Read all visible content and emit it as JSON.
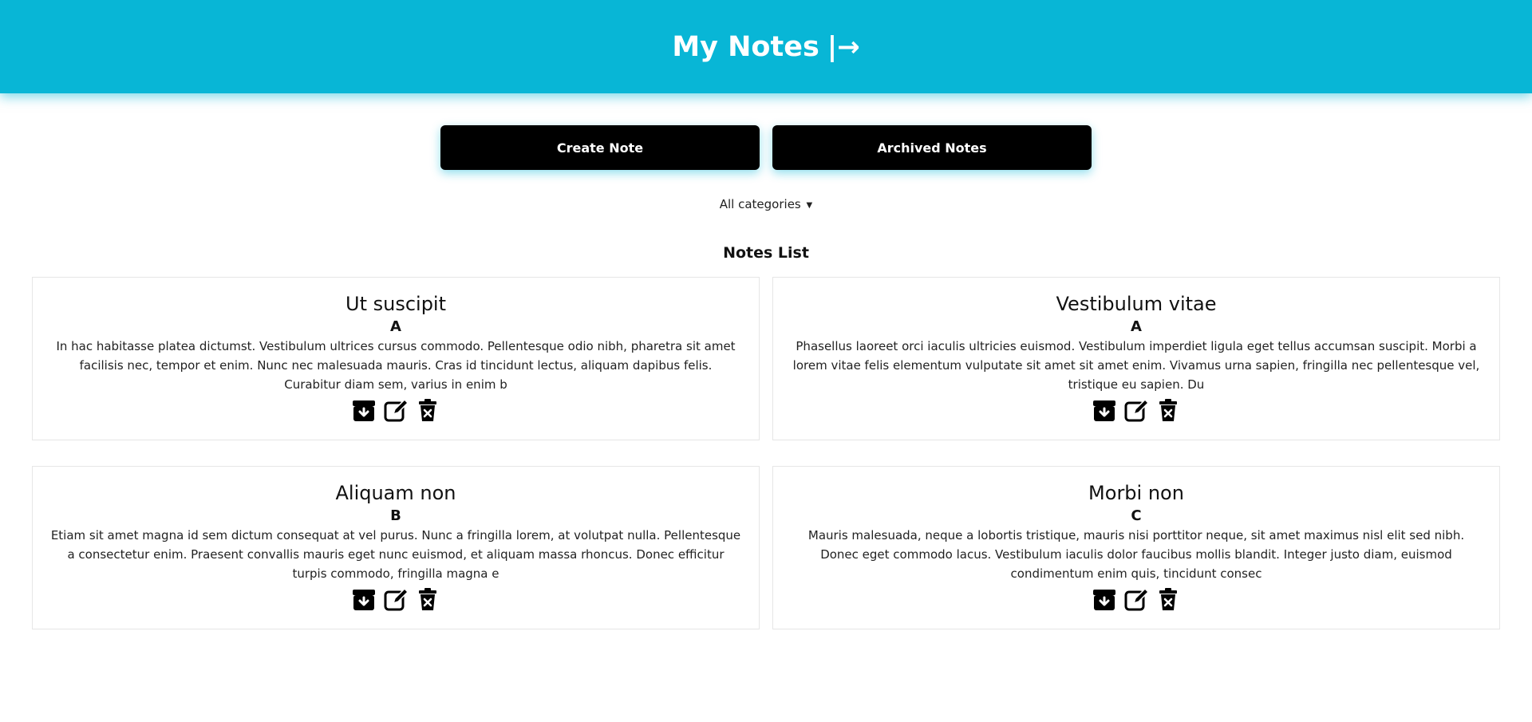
{
  "header": {
    "title": "My Notes",
    "logout_glyph": "|→"
  },
  "actions": {
    "create_label": "Create Note",
    "archived_label": "Archived Notes"
  },
  "filter": {
    "selected": "All categories"
  },
  "list": {
    "title": "Notes List"
  },
  "notes": [
    {
      "title": "Ut suscipit",
      "category": "A",
      "body": "In hac habitasse platea dictumst. Vestibulum ultrices cursus commodo. Pellentesque odio nibh, pharetra sit amet facilisis nec, tempor et enim. Nunc nec malesuada mauris. Cras id tincidunt lectus, aliquam dapibus felis. Curabitur diam sem, varius in enim b"
    },
    {
      "title": "Vestibulum vitae",
      "category": "A",
      "body": "Phasellus laoreet orci iaculis ultricies euismod. Vestibulum imperdiet ligula eget tellus accumsan suscipit. Morbi a lorem vitae felis elementum vulputate sit amet sit amet enim. Vivamus urna sapien, fringilla nec pellentesque vel, tristique eu sapien. Du"
    },
    {
      "title": "Aliquam non",
      "category": "B",
      "body": "Etiam sit amet magna id sem dictum consequat at vel purus. Nunc a fringilla lorem, at volutpat nulla. Pellentesque a consectetur enim. Praesent convallis mauris eget nunc euismod, et aliquam massa rhoncus. Donec efficitur turpis commodo, fringilla magna e"
    },
    {
      "title": "Morbi non",
      "category": "C",
      "body": "Mauris malesuada, neque a lobortis tristique, mauris nisi porttitor neque, sit amet maximus nisl elit sed nibh. Donec eget commodo lacus. Vestibulum iaculis dolor faucibus mollis blandit. Integer justo diam, euismod condimentum enim quis, tincidunt consec"
    }
  ],
  "icons": {
    "archive": "archive-icon",
    "edit": "edit-icon",
    "delete": "delete-icon"
  },
  "colors": {
    "header_bg": "#08b6d6",
    "button_bg": "#000000"
  }
}
